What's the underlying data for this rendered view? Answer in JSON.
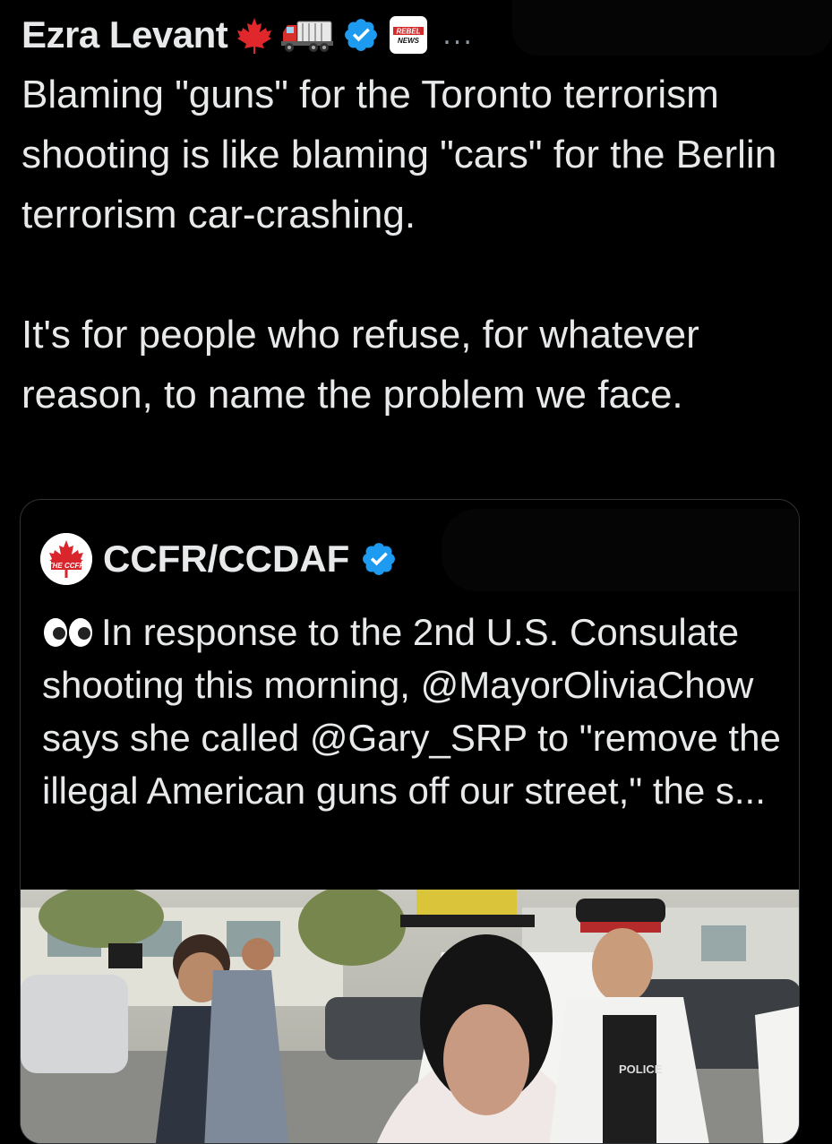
{
  "tweet": {
    "author_name": "Ezra Levant",
    "more_label": "...",
    "badge_text": "REBEL NEWS",
    "paragraphs": [
      "Blaming \"guns\" for the Toronto terrorism shooting is like blaming \"cars\" for the Berlin terrorism car-crashing.",
      "It's for people who refuse, for whatever reason, to name the problem we face."
    ]
  },
  "quote": {
    "author_name": "CCFR/CCDAF",
    "avatar_text": "THE CCFR",
    "text": "In response to the 2nd U.S. Consulate shooting this morning, @MayorOliviaChow says she called @Gary_SRP to \"remove the illegal American guns off our street,\" the s...",
    "image_caption": "POLICE"
  },
  "colors": {
    "background": "#000000",
    "text": "#e7e9ea",
    "verified": "#1d9bf0",
    "border": "#2f3336"
  },
  "icons": [
    "maple-leaf-icon",
    "truck-icon",
    "verified-badge-icon",
    "eyes-icon"
  ]
}
